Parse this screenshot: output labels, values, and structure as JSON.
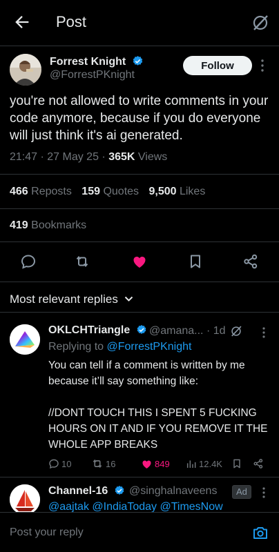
{
  "header": {
    "title": "Post",
    "back_icon": "arrow-left-icon",
    "grok_icon": "grok-slash-icon"
  },
  "post": {
    "author_name": "Forrest Knight",
    "author_handle": "@ForrestPKnight",
    "follow_label": "Follow",
    "text": "you're not allowed to write comments in your code anymore, because if you do everyone will just think it's ai generated.",
    "time": "21:47 · 27 May 25 · ",
    "views_count": "365K",
    "views_label": " Views",
    "reposts_count": "466",
    "reposts_label": " Reposts",
    "quotes_count": "159",
    "quotes_label": " Quotes",
    "likes_count": "9,500",
    "likes_label": " Likes",
    "bookmarks_count": "419",
    "bookmarks_label": " Bookmarks"
  },
  "actions": [
    "reply-icon",
    "repost-icon",
    "like-icon",
    "bookmark-icon",
    "share-icon"
  ],
  "replies_filter": "Most relevant replies",
  "reply1": {
    "name": "OKLCHTriangle",
    "handle": "@amana...",
    "time": " · 1d",
    "replying_prefix": "Replying to ",
    "replying_to": "@ForrestPKnight",
    "body": "You can tell if a comment is written by me because it’ll say something like:\n\n//DONT TOUCH THIS I SPENT 5 FUCKING HOURS ON IT AND IF YOU REMOVE IT THE WHOLE APP BREAKS",
    "replies": "10",
    "reposts": "16",
    "likes": "849",
    "views": "12.4K"
  },
  "reply2": {
    "name": "Channel-16",
    "handle": "@singhalnaveens",
    "ad_label": "Ad",
    "mentions": "@aajtak @IndiaToday @TimesNow"
  },
  "composer": {
    "placeholder": "Post your reply",
    "camera_icon": "camera-icon"
  },
  "colors": {
    "accent": "#1d9bf0",
    "like": "#f91880",
    "muted": "#71767b",
    "text": "#e7e9ea",
    "background": "#000000"
  }
}
